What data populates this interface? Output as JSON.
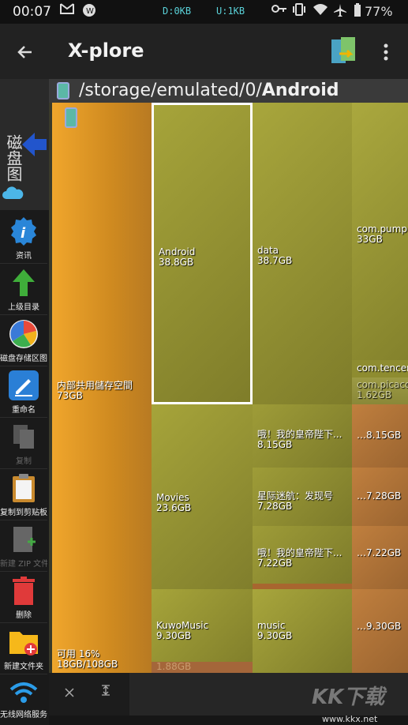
{
  "status_bar": {
    "time": "00:07",
    "download": "D:0KB",
    "upload": "U:1KB",
    "battery": "77%",
    "icons": [
      "gmail-icon",
      "weather-icon",
      "key-icon",
      "vibrate-icon",
      "wifi-icon",
      "airplane-icon",
      "battery-icon"
    ]
  },
  "app_bar": {
    "title": "X-plore",
    "back_icon": "arrow-back-icon",
    "panes_icon": "switch-panes-icon",
    "menu_icon": "more-vert-icon"
  },
  "sidebar": {
    "map_label": "磁盘图",
    "tools": [
      {
        "label": "资讯",
        "icon": "info-icon",
        "enabled": true
      },
      {
        "label": "上级目录",
        "icon": "up-arrow-icon",
        "enabled": true
      },
      {
        "label": "磁盘存储区图",
        "icon": "disk-map-icon",
        "enabled": true
      },
      {
        "label": "重命名",
        "icon": "rename-icon",
        "enabled": true
      },
      {
        "label": "复制",
        "icon": "copy-icon",
        "enabled": false
      },
      {
        "label": "复制到剪贴板",
        "icon": "clipboard-icon",
        "enabled": true
      },
      {
        "label": "新建 ZIP 文件",
        "icon": "zip-icon",
        "enabled": false
      },
      {
        "label": "删除",
        "icon": "trash-icon",
        "enabled": true
      },
      {
        "label": "新建文件夹",
        "icon": "new-folder-icon",
        "enabled": true
      },
      {
        "label": "无线网络服务",
        "icon": "wifi-server-icon",
        "enabled": true
      }
    ]
  },
  "path_bar": {
    "prefix": "/storage/emulated/0/",
    "current": "Android"
  },
  "treemap": {
    "blocks": [
      {
        "name": "内部共用儲存空間",
        "size": "73GB"
      },
      {
        "name": "可用 16%",
        "size": "18GB/108GB"
      },
      {
        "name": "Android",
        "size": "38.8GB"
      },
      {
        "name": "data",
        "size": "38.7GB"
      },
      {
        "name": "com.pumpk",
        "size": "33GB"
      },
      {
        "name": "com.tencen",
        "size": ""
      },
      {
        "name": "com.picaco",
        "size": "1.62GB"
      },
      {
        "name": "Movies",
        "size": "23.6GB"
      },
      {
        "name": "哦！我的皇帝陛下...",
        "size": "8.15GB"
      },
      {
        "name": "…",
        "size": "8.15GB"
      },
      {
        "name": "星际迷航：发现号",
        "size": "7.28GB"
      },
      {
        "name": "…",
        "size": "7.28GB"
      },
      {
        "name": "哦！我的皇帝陛下...",
        "size": "7.22GB"
      },
      {
        "name": "…",
        "size": "7.22GB"
      },
      {
        "name": "KuwoMusic",
        "size": "9.30GB"
      },
      {
        "name": "music",
        "size": "9.30GB"
      },
      {
        "name": "…",
        "size": "9.30GB"
      },
      {
        "name": "",
        "size": "1.88GB"
      }
    ]
  },
  "bottom_bar": {
    "close_icon": "close-icon",
    "expand_icon": "expand-icon"
  },
  "watermark": {
    "text": "KK下载",
    "url": "www.kkx.net"
  }
}
